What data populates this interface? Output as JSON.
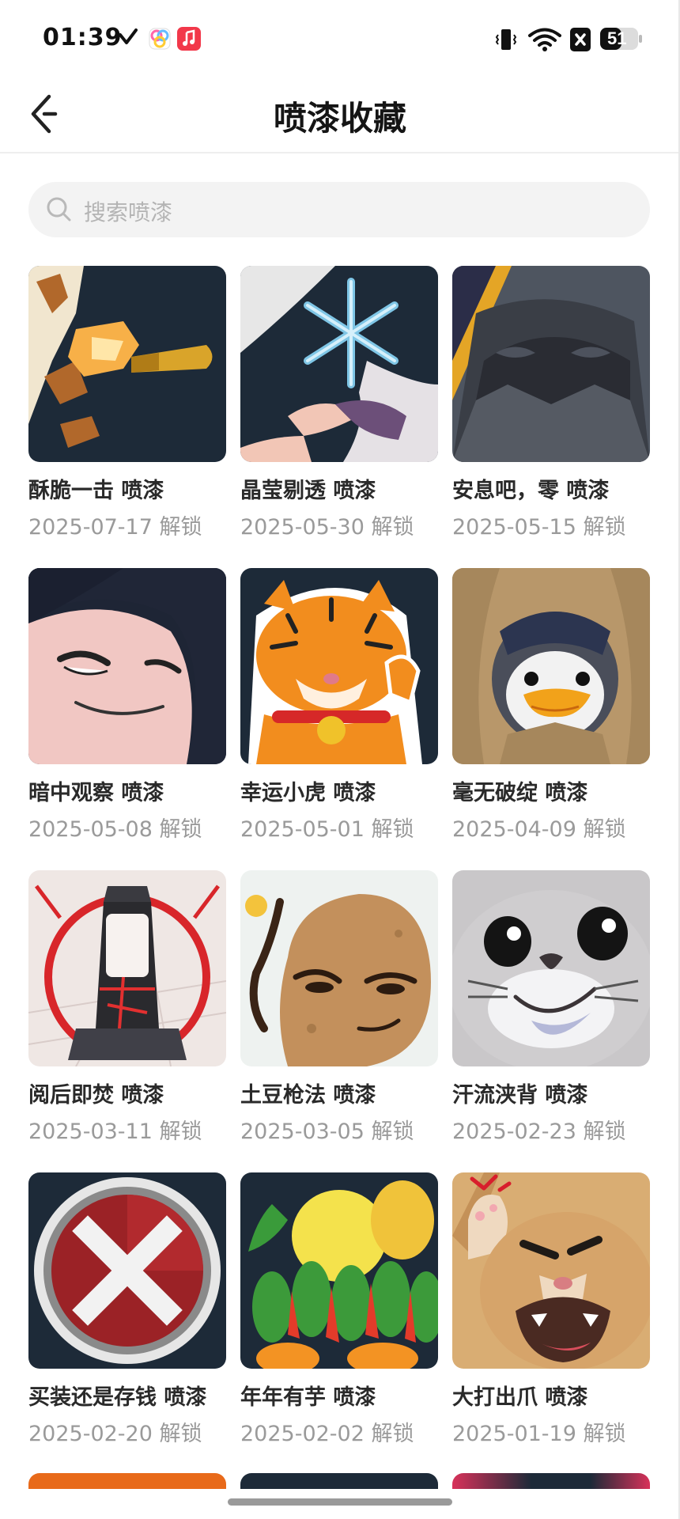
{
  "status_bar": {
    "time": "01:39",
    "battery": "51",
    "icons": [
      "check-icon",
      "colorful-app-icon",
      "music-app-icon",
      "vibrate-icon",
      "wifi-icon",
      "sim-off-icon",
      "battery-icon"
    ]
  },
  "header": {
    "title": "喷漆收藏",
    "back_icon": "back-arrow-icon"
  },
  "search": {
    "placeholder": "搜索喷漆",
    "icon": "search-icon"
  },
  "sprays": [
    {
      "name": "酥脆一击 喷漆",
      "date": "2025-07-17 解锁",
      "art": "bullet"
    },
    {
      "name": "晶莹剔透 喷漆",
      "date": "2025-05-30 解锁",
      "art": "snowflake"
    },
    {
      "name": "安息吧，零 喷漆",
      "date": "2025-05-15 解锁",
      "art": "masked-face"
    },
    {
      "name": "暗中观察 喷漆",
      "date": "2025-05-08 解锁",
      "art": "peeking-face"
    },
    {
      "name": "幸运小虎 喷漆",
      "date": "2025-05-01 解锁",
      "art": "lucky-tiger"
    },
    {
      "name": "毫无破绽 喷漆",
      "date": "2025-04-09 解锁",
      "art": "penguin-hood"
    },
    {
      "name": "阅后即焚 喷漆",
      "date": "2025-03-11 解锁",
      "art": "red-tower"
    },
    {
      "name": "土豆枪法 喷漆",
      "date": "2025-03-05 解锁",
      "art": "smug-potato"
    },
    {
      "name": "汗流浃背 喷漆",
      "date": "2025-02-23 解锁",
      "art": "seal"
    },
    {
      "name": "买装还是存钱 喷漆",
      "date": "2025-02-20 解锁",
      "art": "red-x-button"
    },
    {
      "name": "年年有芋 喷漆",
      "date": "2025-02-02 解锁",
      "art": "veggie-basket"
    },
    {
      "name": "大打出爪 喷漆",
      "date": "2025-01-19 解锁",
      "art": "angry-cat"
    }
  ],
  "colors": {
    "card_dark": "#1d2a38",
    "placeholder": "#b4b4b4",
    "date_text": "#9a9a9a",
    "search_bg": "#f3f3f3"
  }
}
